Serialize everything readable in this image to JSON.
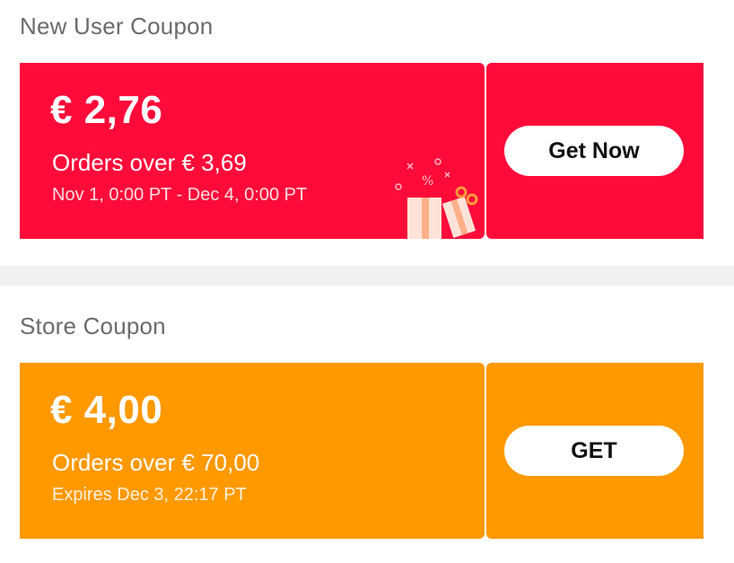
{
  "new_user_coupon": {
    "section_title": "New User Coupon",
    "amount": "€ 2,76",
    "condition": "Orders over € 3,69",
    "validity": "Nov 1, 0:00 PT - Dec 4, 0:00 PT",
    "button_label": "Get Now",
    "color": "#ff0b3a",
    "decoration_icon": "gift-box-icon"
  },
  "store_coupon": {
    "section_title": "Store Coupon",
    "amount": "€ 4,00",
    "condition": "Orders over € 70,00",
    "validity": "Expires Dec 3, 22:17 PT",
    "button_label": "GET",
    "color": "#ff9900"
  }
}
